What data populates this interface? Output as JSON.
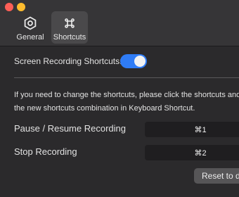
{
  "toolbar": {
    "tabs": [
      {
        "label": "General",
        "icon": "general-settings-icon"
      },
      {
        "label": "Shortcuts",
        "icon": "command-key-icon",
        "selected": true
      }
    ]
  },
  "colors": {
    "accent": "#2f7cf6",
    "close": "#fe5f57",
    "minimize": "#febc2e"
  },
  "settings": {
    "recording_toggle_label": "Screen Recording Shortcuts:",
    "recording_toggle_on": true,
    "info_line1": "If you need to change the shortcuts, please click the shortcuts and re",
    "info_line2": "the new shortcuts combination in Keyboard Shortcut.",
    "shortcuts": [
      {
        "label": "Pause / Resume Recording",
        "keys": "⌘1"
      },
      {
        "label": "Stop Recording",
        "keys": "⌘2"
      }
    ],
    "reset_label": "Reset to de"
  }
}
